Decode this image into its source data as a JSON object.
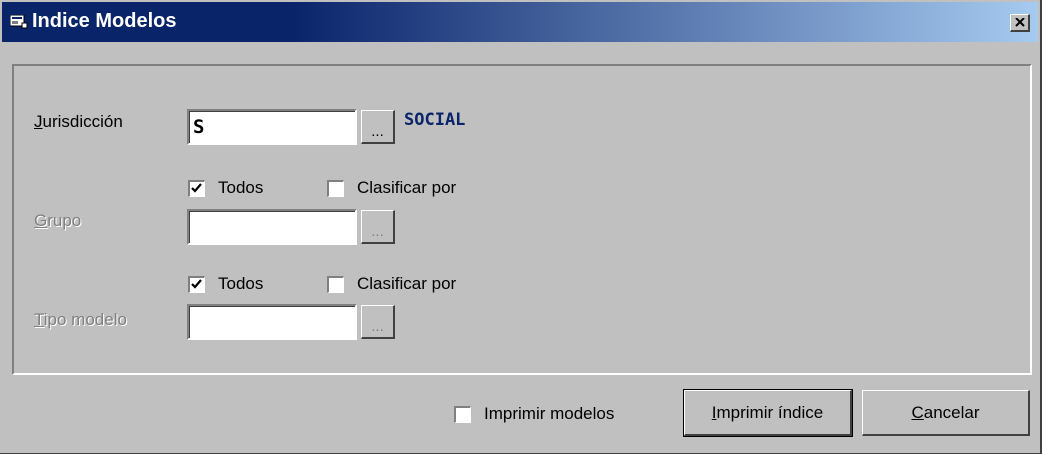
{
  "window": {
    "title": "Indice Modelos"
  },
  "form": {
    "jurisdiccion": {
      "label_access": "J",
      "label_rest": "urisdicción",
      "value": "S",
      "browse_label": "...",
      "resolved_name": "SOCIAL"
    },
    "grupo": {
      "todos_label": "Todos",
      "todos_checked": true,
      "clasificar_label": "Clasificar por",
      "clasificar_checked": false,
      "label_access": "G",
      "label_rest": "rupo",
      "value": "",
      "browse_label": "..."
    },
    "tipo_modelo": {
      "todos_label": "Todos",
      "todos_checked": true,
      "clasificar_label": "Clasificar por",
      "clasificar_checked": false,
      "label_access": "T",
      "label_rest": "ipo modelo",
      "value": "",
      "browse_label": "..."
    }
  },
  "footer": {
    "imprimir_modelos_label": "Imprimir modelos",
    "imprimir_modelos_checked": false,
    "print_button": {
      "access": "I",
      "rest": "mprimir índice"
    },
    "cancel_button": {
      "access": "C",
      "rest": "ancelar"
    }
  }
}
